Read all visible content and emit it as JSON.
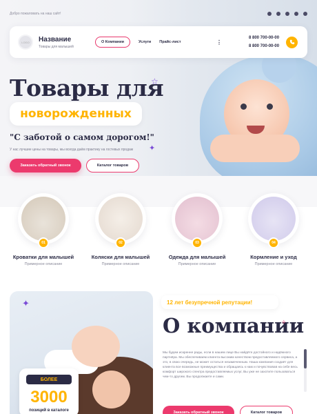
{
  "topbar": {
    "welcome": "Добро пожаловать на наш сайт!",
    "socials": [
      "vk-icon",
      "youtube-icon",
      "ok-icon",
      "skype-icon",
      "telegram-icon"
    ]
  },
  "header": {
    "logo_text": "LOGO",
    "brand_name": "Название",
    "brand_sub": "Товары для малышей",
    "nav": [
      "О Компании",
      "Услуги",
      "Прайс-лист"
    ],
    "more": "⋮",
    "phone1": "8 800 700-00-00",
    "phone2": "8 800 700-00-00"
  },
  "hero": {
    "title_line1": "Товары для",
    "title_line2": "новорожденных",
    "slogan": "\"С заботой о самом дорогом!\"",
    "description": "У нас лучшие цены на товары, мы всегда даём практику на гостевых продаж",
    "btn_primary": "Заказать обратный звонок",
    "btn_outline": "Каталог товаров"
  },
  "categories": [
    {
      "num": "01",
      "title": "Кроватки для малышей",
      "sub": "Примерное описание"
    },
    {
      "num": "02",
      "title": "Коляски для малышей",
      "sub": "Примерное описание"
    },
    {
      "num": "03",
      "title": "Одежда для малышей",
      "sub": "Примерное описание"
    },
    {
      "num": "04",
      "title": "Кормление и уход",
      "sub": "Примерное описание"
    }
  ],
  "about": {
    "reputation": "12 лет безупречной репутации!",
    "title": "О компании",
    "text": "Мы будем искренне рады, если в нашем лице Вы найдёте достойного и надёжного партнёра. Мы обеспечиваем клиента высоким качеством предоставляемого сервиса, а это, в свою очередь, не может остаться незамеченным. Наша компания создаёт для клиента все возможные преимущества и обращаясь к нам и почувствовав на себе весь комфорт широкого спектра предоставляемых услуг, Вы уже не захотите пользоваться чем-то другим. Вы продолжаете и сами.",
    "counter_badge": "БОЛЕЕ",
    "counter_num": "3000",
    "counter_label": "позиций в каталоге",
    "btn_primary": "Заказать обратный звонок",
    "btn_outline": "Каталог товаров"
  },
  "colors": {
    "accent_pink": "#ec3a6d",
    "accent_yellow": "#ffb400",
    "dark": "#2b2b45"
  }
}
